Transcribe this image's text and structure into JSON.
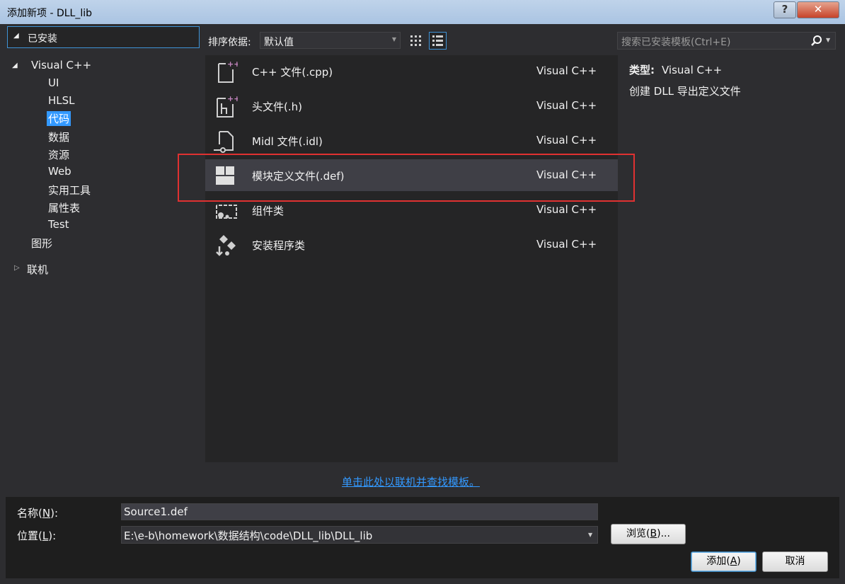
{
  "window": {
    "title": "添加新项 - DLL_lib",
    "help_label": "?",
    "close_label": "✕"
  },
  "sidebar": {
    "installed_label": "已安装",
    "tree": [
      {
        "label": "Visual C++",
        "level": 1,
        "expanded": true
      },
      {
        "label": "UI",
        "level": 2
      },
      {
        "label": "HLSL",
        "level": 2
      },
      {
        "label": "代码",
        "level": 2,
        "selected": true
      },
      {
        "label": "数据",
        "level": 2
      },
      {
        "label": "资源",
        "level": 2
      },
      {
        "label": "Web",
        "level": 2
      },
      {
        "label": "实用工具",
        "level": 2
      },
      {
        "label": "属性表",
        "level": 2
      },
      {
        "label": "Test",
        "level": 2
      },
      {
        "label": "图形",
        "level": 1
      },
      {
        "label": "联机",
        "level": 0,
        "expanded": false
      }
    ]
  },
  "toolbar": {
    "sort_label": "排序依据:",
    "sort_value": "默认值",
    "search_placeholder": "搜索已安装模板(Ctrl+E)"
  },
  "templates": [
    {
      "name": "C++ 文件(.cpp)",
      "type": "Visual C++",
      "icon": "cpp-file-icon"
    },
    {
      "name": "头文件(.h)",
      "type": "Visual C++",
      "icon": "header-file-icon"
    },
    {
      "name": "Midl 文件(.idl)",
      "type": "Visual C++",
      "icon": "midl-file-icon"
    },
    {
      "name": "模块定义文件(.def)",
      "type": "Visual C++",
      "icon": "module-def-icon",
      "selected": true
    },
    {
      "name": "组件类",
      "type": "Visual C++",
      "icon": "component-class-icon"
    },
    {
      "name": "安装程序类",
      "type": "Visual C++",
      "icon": "installer-class-icon"
    }
  ],
  "details": {
    "type_label": "类型:",
    "type_value": "Visual C++",
    "description": "创建 DLL 导出定义文件"
  },
  "online_link": "单击此处以联机并查找模板。",
  "form": {
    "name_label": "名称(",
    "name_key": "N",
    "name_label_end": "):",
    "name_value": "Source1.def",
    "location_label": "位置(",
    "location_key": "L",
    "location_label_end": "):",
    "location_value": "E:\\e-b\\homework\\数据结构\\code\\DLL_lib\\DLL_lib",
    "browse_label": "浏览(",
    "browse_key": "B",
    "browse_label_end": ")...",
    "add_label": "添加(",
    "add_key": "A",
    "add_label_end": ")",
    "cancel_label": "取消"
  },
  "colors": {
    "accent": "#3399ff",
    "highlight_box": "#e03131",
    "background": "#2d2d30"
  }
}
